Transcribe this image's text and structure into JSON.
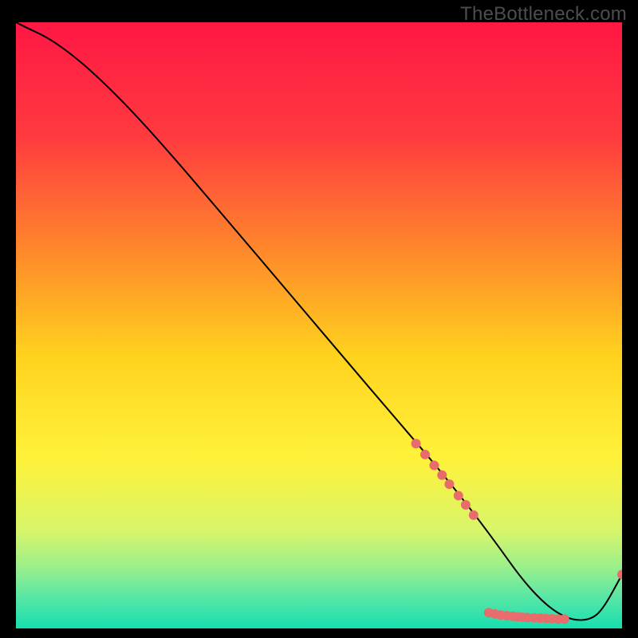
{
  "watermark": "TheBottleneck.com",
  "chart_data": {
    "type": "line",
    "title": "",
    "xlabel": "",
    "ylabel": "",
    "xlim": [
      0,
      100
    ],
    "ylim": [
      0,
      100
    ],
    "grid": false,
    "legend": false,
    "gradient_stops": [
      {
        "offset": 0.0,
        "color": "#ff1744"
      },
      {
        "offset": 0.19,
        "color": "#ff3b3f"
      },
      {
        "offset": 0.38,
        "color": "#ff8a2b"
      },
      {
        "offset": 0.55,
        "color": "#ffd21e"
      },
      {
        "offset": 0.72,
        "color": "#fff23a"
      },
      {
        "offset": 0.84,
        "color": "#d7f56a"
      },
      {
        "offset": 0.9,
        "color": "#99ef8c"
      },
      {
        "offset": 0.95,
        "color": "#56e6a6"
      },
      {
        "offset": 1.0,
        "color": "#17dfb0"
      }
    ],
    "series": [
      {
        "name": "curve",
        "color": "#000000",
        "x": [
          0,
          2,
          5,
          8,
          12,
          18,
          25,
          35,
          45,
          55,
          62,
          68,
          72,
          76,
          80,
          83,
          86,
          89,
          92,
          95,
          97,
          100
        ],
        "y": [
          100,
          99,
          97.6,
          95.6,
          92.4,
          86.6,
          78.9,
          67.2,
          55.4,
          43.6,
          35.4,
          28.4,
          23.5,
          18.4,
          13.0,
          8.8,
          5.3,
          2.7,
          1.3,
          1.5,
          3.4,
          8.9
        ]
      }
    ],
    "scatter": {
      "color": "#e86c6c",
      "radius": 6,
      "points": [
        {
          "x": 66,
          "y": 30.5
        },
        {
          "x": 67.5,
          "y": 28.7
        },
        {
          "x": 69,
          "y": 26.9
        },
        {
          "x": 70.3,
          "y": 25.3
        },
        {
          "x": 71.5,
          "y": 23.8
        },
        {
          "x": 73,
          "y": 21.9
        },
        {
          "x": 74.2,
          "y": 20.4
        },
        {
          "x": 75.5,
          "y": 18.7
        },
        {
          "x": 78,
          "y": 2.6
        },
        {
          "x": 79,
          "y": 2.4
        },
        {
          "x": 80,
          "y": 2.2
        },
        {
          "x": 81,
          "y": 2.1
        },
        {
          "x": 82,
          "y": 2.0
        },
        {
          "x": 82.8,
          "y": 1.9
        },
        {
          "x": 83.6,
          "y": 1.85
        },
        {
          "x": 84.4,
          "y": 1.8
        },
        {
          "x": 85.5,
          "y": 1.75
        },
        {
          "x": 86.5,
          "y": 1.7
        },
        {
          "x": 87.5,
          "y": 1.65
        },
        {
          "x": 88.5,
          "y": 1.6
        },
        {
          "x": 89.5,
          "y": 1.55
        },
        {
          "x": 90.5,
          "y": 1.55
        },
        {
          "x": 100,
          "y": 8.9
        }
      ]
    }
  }
}
